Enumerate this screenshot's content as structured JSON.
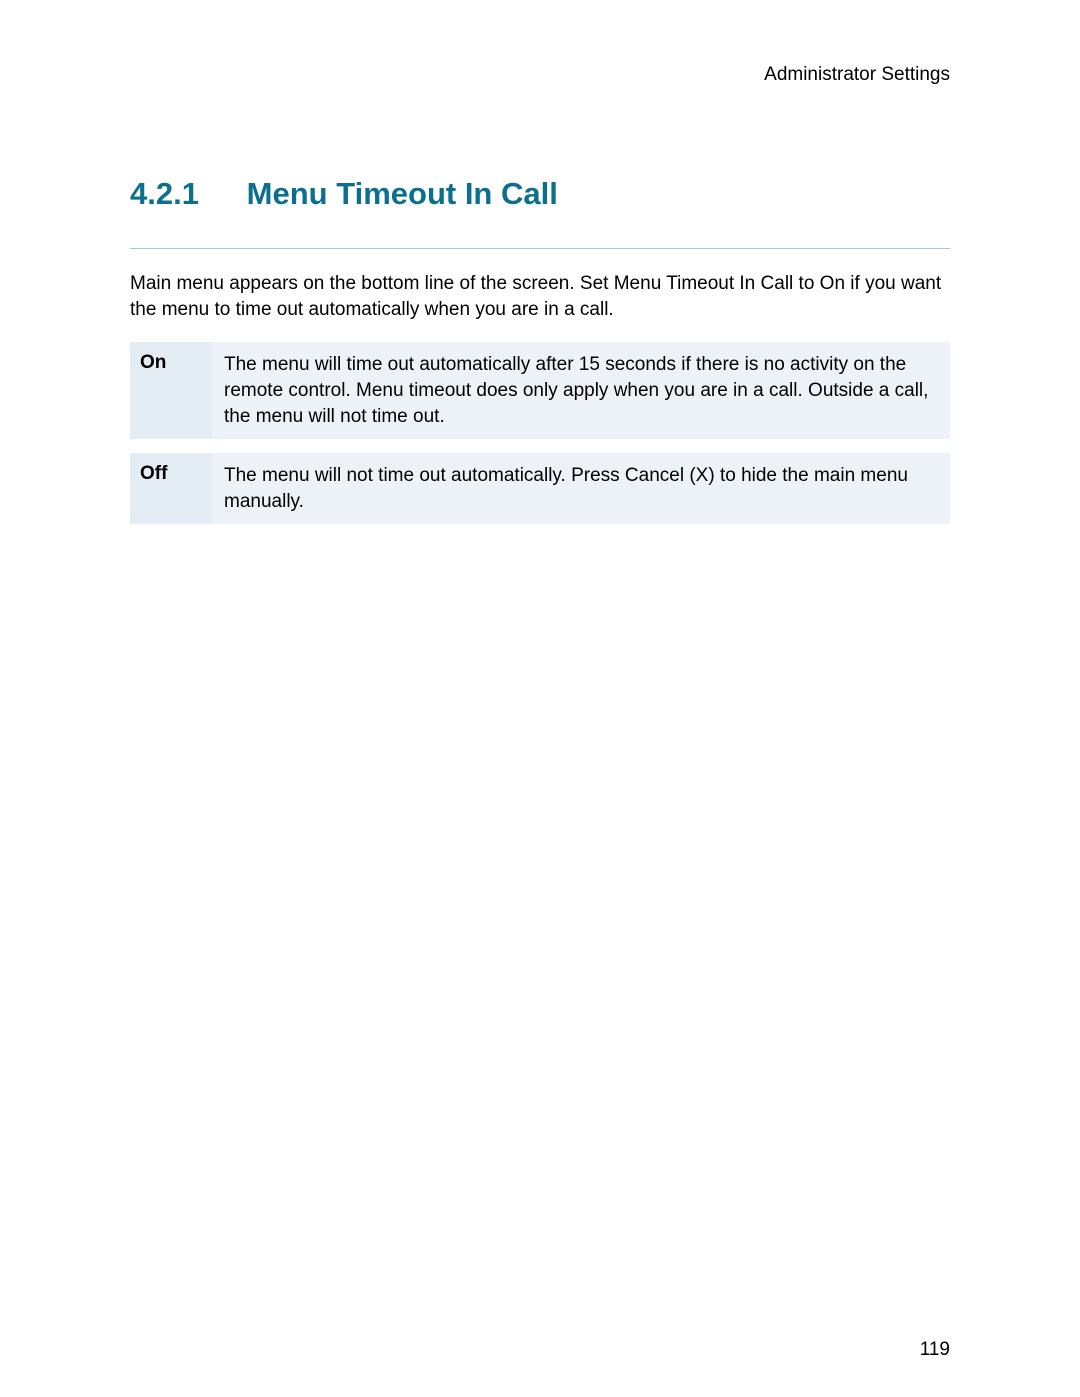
{
  "header": {
    "category": "Administrator Settings"
  },
  "section": {
    "number": "4.2.1",
    "title": "Menu Timeout In Call"
  },
  "intro": "Main menu appears on the bottom line of the screen. Set Menu Timeout In Call to On if you want the menu to time out automatically when you are in a call.",
  "options": [
    {
      "label": "On",
      "desc": "The menu will time out automatically after 15 seconds if there is no activity on the remote control. Menu timeout does only apply when you are in a call. Outside a call, the menu will not time out."
    },
    {
      "label": "Off",
      "desc": "The menu will not time out automatically. Press Cancel (X) to hide the main menu manually."
    }
  ],
  "page_number": "119"
}
